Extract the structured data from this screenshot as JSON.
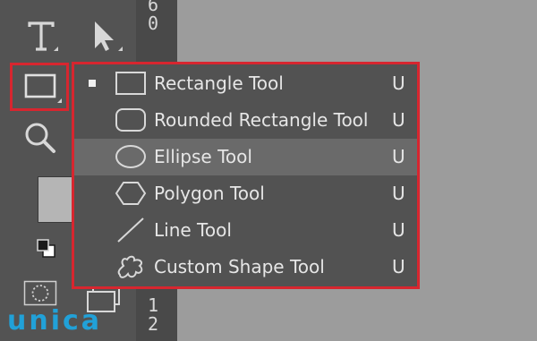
{
  "ruler": {
    "digits_top": [
      "6",
      "0"
    ],
    "digits_bottom": [
      "1",
      "2"
    ]
  },
  "menu": {
    "items": [
      {
        "label": "Rectangle Tool",
        "shortcut": "U",
        "icon": "rectangle-icon",
        "selected": true,
        "hovered": false
      },
      {
        "label": "Rounded Rectangle Tool",
        "shortcut": "U",
        "icon": "rounded-rectangle-icon",
        "selected": false,
        "hovered": false
      },
      {
        "label": "Ellipse Tool",
        "shortcut": "U",
        "icon": "ellipse-icon",
        "selected": false,
        "hovered": true
      },
      {
        "label": "Polygon Tool",
        "shortcut": "U",
        "icon": "polygon-icon",
        "selected": false,
        "hovered": false
      },
      {
        "label": "Line Tool",
        "shortcut": "U",
        "icon": "line-icon",
        "selected": false,
        "hovered": false
      },
      {
        "label": "Custom Shape Tool",
        "shortcut": "U",
        "icon": "custom-shape-icon",
        "selected": false,
        "hovered": false
      }
    ]
  },
  "toolbar": {
    "tools": [
      "type-tool-icon",
      "path-selection-tool-icon",
      "rectangle-tool-icon",
      "zoom-tool-icon",
      "foreground-color-swatch",
      "default-colors-icon",
      "quick-mask-icon",
      "screen-mode-icon"
    ]
  },
  "colors": {
    "highlight_border": "#d7262f",
    "menu_bg": "#525252",
    "hover_bg": "#6a6a6a",
    "watermark": "#21a1d8"
  },
  "watermark": {
    "text": "unica"
  }
}
